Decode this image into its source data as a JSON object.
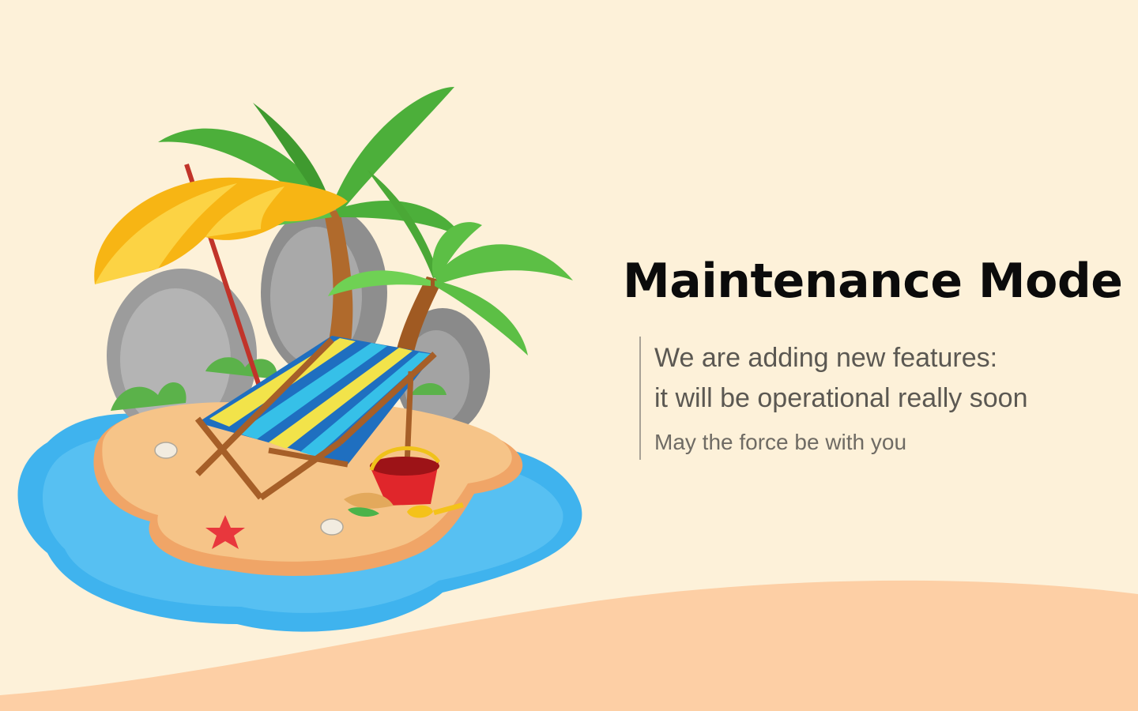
{
  "page": {
    "title": "Maintenance Mode",
    "message_lines": [
      "We are adding new features:",
      "it will be operational really soon"
    ],
    "tagline": "May the force be with you"
  },
  "illustration": {
    "icon": "tropical-island-illustration"
  },
  "colors": {
    "background": "#fdf1d9",
    "sand_hill": "#fdcfa5",
    "title": "#0b0b0b",
    "message": "#5b5852",
    "divider": "#a8a296"
  }
}
